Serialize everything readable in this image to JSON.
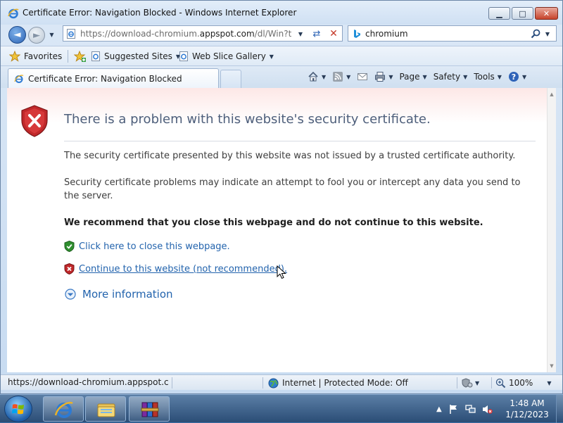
{
  "window": {
    "title": "Certificate Error: Navigation Blocked - Windows Internet Explorer",
    "minimize_glyph": "▁",
    "maximize_glyph": "□",
    "close_glyph": "✕"
  },
  "navigation": {
    "back_glyph": "◄",
    "forward_glyph": "►",
    "address_url_prefix": "https://download-chromium.",
    "address_url_domain": "appspot.com",
    "address_url_suffix": "/dl/Win?type=",
    "search_query": "chromium"
  },
  "favorites_bar": {
    "favorites_label": "Favorites",
    "items": [
      {
        "label": "Suggested Sites"
      },
      {
        "label": "Web Slice Gallery"
      }
    ]
  },
  "tabs": [
    {
      "label": "Certificate Error: Navigation Blocked",
      "active": true
    }
  ],
  "command_bar": {
    "page_label": "Page",
    "safety_label": "Safety",
    "tools_label": "Tools"
  },
  "page": {
    "title": "There is a problem with this website's security certificate.",
    "paragraph1": "The security certificate presented by this website was not issued by a trusted certificate authority.",
    "paragraph2": "Security certificate problems may indicate an attempt to fool you or intercept any data you send to the server.",
    "recommendation": "We recommend that you close this webpage and do not continue to this website.",
    "close_link": "Click here to close this webpage.",
    "continue_link": "Continue to this website (not recommended).",
    "more_info": "More information"
  },
  "status_bar": {
    "url": "https://download-chromium.appspot.con",
    "zone": "Internet | Protected Mode: Off",
    "zoom": "100%"
  },
  "taskbar": {
    "time": "1:48 AM",
    "date": "1/12/2023"
  },
  "colors": {
    "link": "#2263ad",
    "title_text": "#4e5f7b",
    "error_red": "#c0282a",
    "safe_green": "#2f8f2f"
  }
}
